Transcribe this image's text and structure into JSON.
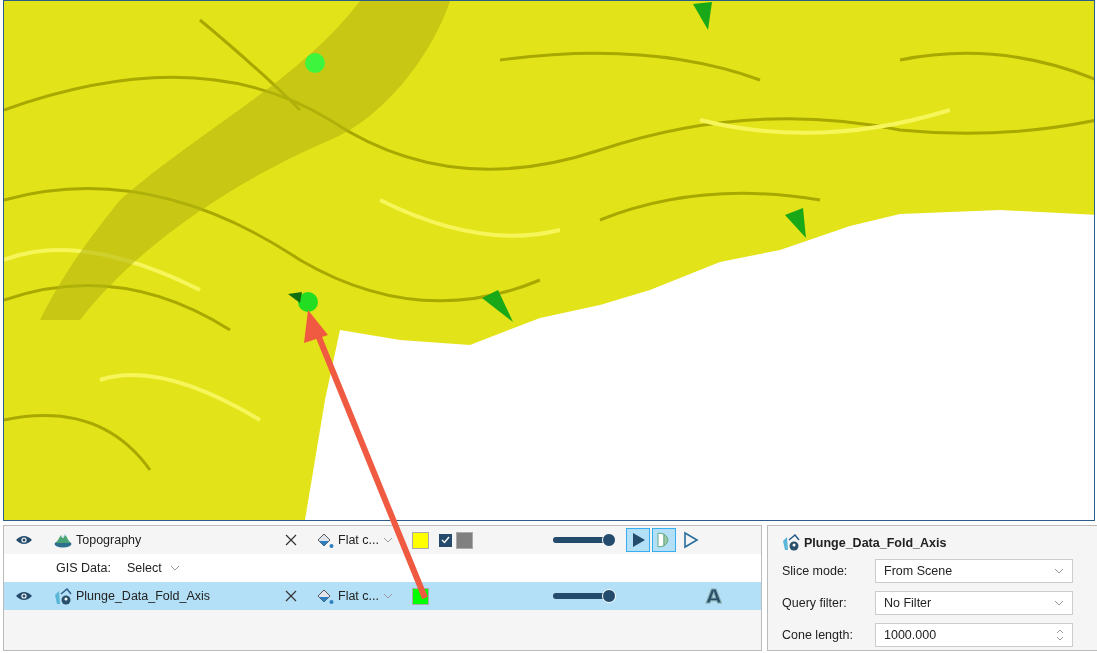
{
  "layers": [
    {
      "kind": "surface",
      "name": "Topography",
      "selected": false,
      "color_mode": "Flat c...",
      "swatch": {
        "color": "#ffff00"
      },
      "backface": {
        "checked": true,
        "color": "#808080"
      },
      "opacity": {
        "level": 1
      },
      "toggles": [
        {
          "kind": "play",
          "on": true
        },
        {
          "kind": "slice",
          "on": true
        },
        {
          "kind": "outline",
          "on": false
        }
      ],
      "sub": {
        "label": "GIS Data:",
        "value": "Select"
      }
    },
    {
      "kind": "points",
      "name": "Plunge_Data_Fold_Axis",
      "selected": true,
      "color_mode": "Flat c...",
      "swatch": {
        "color": "#00ff00"
      },
      "opacity": {
        "level": 1
      },
      "label_toggle": {
        "text": "A"
      }
    }
  ],
  "properties": {
    "title": "Plunge_Data_Fold_Axis",
    "fields": [
      {
        "kind": "dropdown",
        "label": "Slice mode:",
        "value": "From Scene"
      },
      {
        "kind": "dropdown",
        "label": "Query filter:",
        "value": "No Filter"
      },
      {
        "kind": "spinner",
        "label": "Cone length:",
        "value": "1000.000"
      }
    ]
  }
}
